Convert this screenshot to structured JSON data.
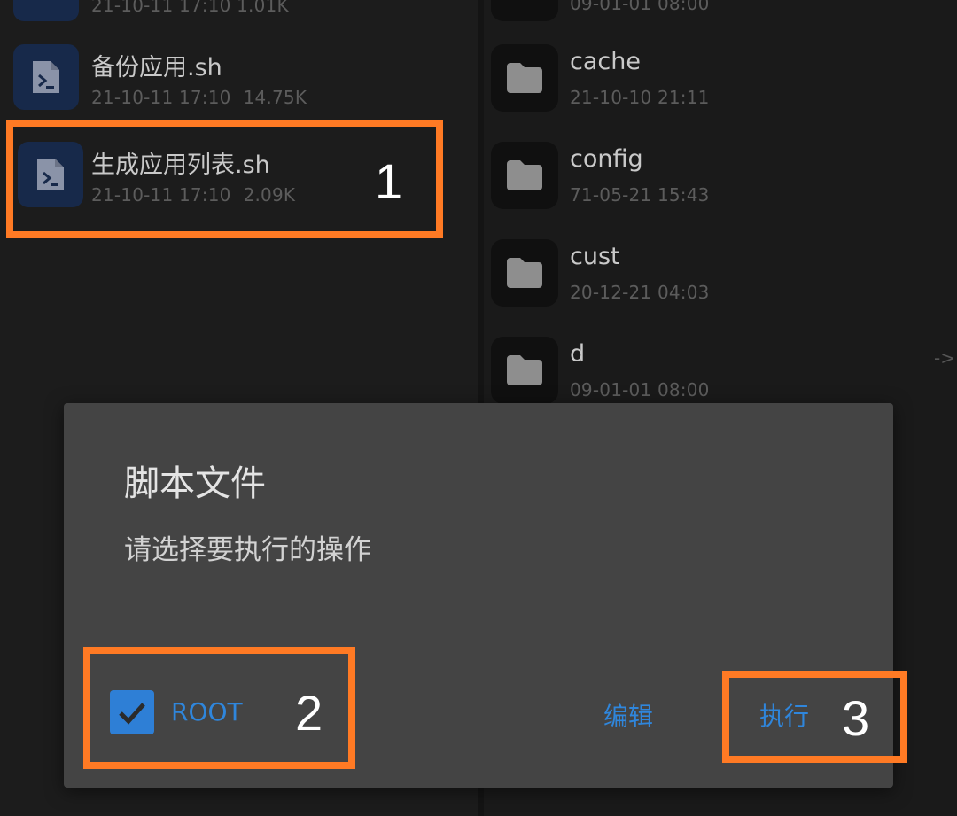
{
  "left_pane": {
    "top_partial_meta": "21-10-11 17:10   1.01K",
    "files": [
      {
        "name": "备份应用.sh",
        "date": "21-10-11 17:10",
        "size": "14.75K"
      },
      {
        "name": "生成应用列表.sh",
        "date": "21-10-11 17:10",
        "size": "2.09K"
      }
    ]
  },
  "right_pane": {
    "top_partial_meta": "09-01-01 08:00",
    "folders": [
      {
        "name": "cache",
        "date": "21-10-10 21:11"
      },
      {
        "name": "config",
        "date": "71-05-21 15:43"
      },
      {
        "name": "cust",
        "date": "20-12-21 04:03"
      },
      {
        "name": "d",
        "date": "09-01-01 08:00"
      }
    ],
    "link_indicator": "->"
  },
  "dialog": {
    "title": "脚本文件",
    "message": "请选择要执行的操作",
    "root_label": "ROOT",
    "root_checked": true,
    "edit_label": "编辑",
    "run_label": "执行"
  },
  "annotations": {
    "marker_1": "1",
    "marker_2": "2",
    "marker_3": "3",
    "color": "#ff7a24"
  },
  "colors": {
    "accent": "#2f86dc",
    "file_icon_bg": "#17294a",
    "dialog_bg": "#444444"
  }
}
